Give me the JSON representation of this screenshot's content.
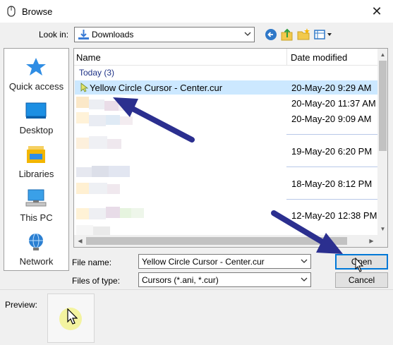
{
  "window": {
    "title": "Browse",
    "close_glyph": "✕"
  },
  "toolbar": {
    "look_in_label": "Look in:",
    "look_in_value": "Downloads",
    "icons": [
      "back-arrow-icon",
      "up-folder-icon",
      "new-folder-icon",
      "view-menu-icon"
    ]
  },
  "places": [
    {
      "label": "Quick access",
      "icon": "star-icon"
    },
    {
      "label": "Desktop",
      "icon": "desktop-icon"
    },
    {
      "label": "Libraries",
      "icon": "libraries-icon"
    },
    {
      "label": "This PC",
      "icon": "computer-icon"
    },
    {
      "label": "Network",
      "icon": "network-icon"
    }
  ],
  "file_list": {
    "columns": [
      "Name",
      "Date modified"
    ],
    "group_label": "Today (3)",
    "selected_file": "Yellow Circle Cursor - Center.cur",
    "dates": [
      "20-May-20 9:29 AM",
      "20-May-20 11:37 AM",
      "20-May-20 9:09 AM",
      "19-May-20 6:20 PM",
      "18-May-20 8:12 PM",
      "12-May-20 12:38 PM"
    ]
  },
  "form": {
    "file_name_label": "File name:",
    "file_name_value": "Yellow Circle Cursor - Center.cur",
    "file_type_label": "Files of type:",
    "file_type_value": "Cursors (*.ani, *.cur)",
    "open_label": "Open",
    "cancel_label": "Cancel"
  },
  "preview": {
    "label": "Preview:"
  },
  "colors": {
    "selection": "#cce8ff",
    "group_header": "#1e3287",
    "annotation_arrow": "#2b2f8f",
    "accent": "#0078d7"
  }
}
